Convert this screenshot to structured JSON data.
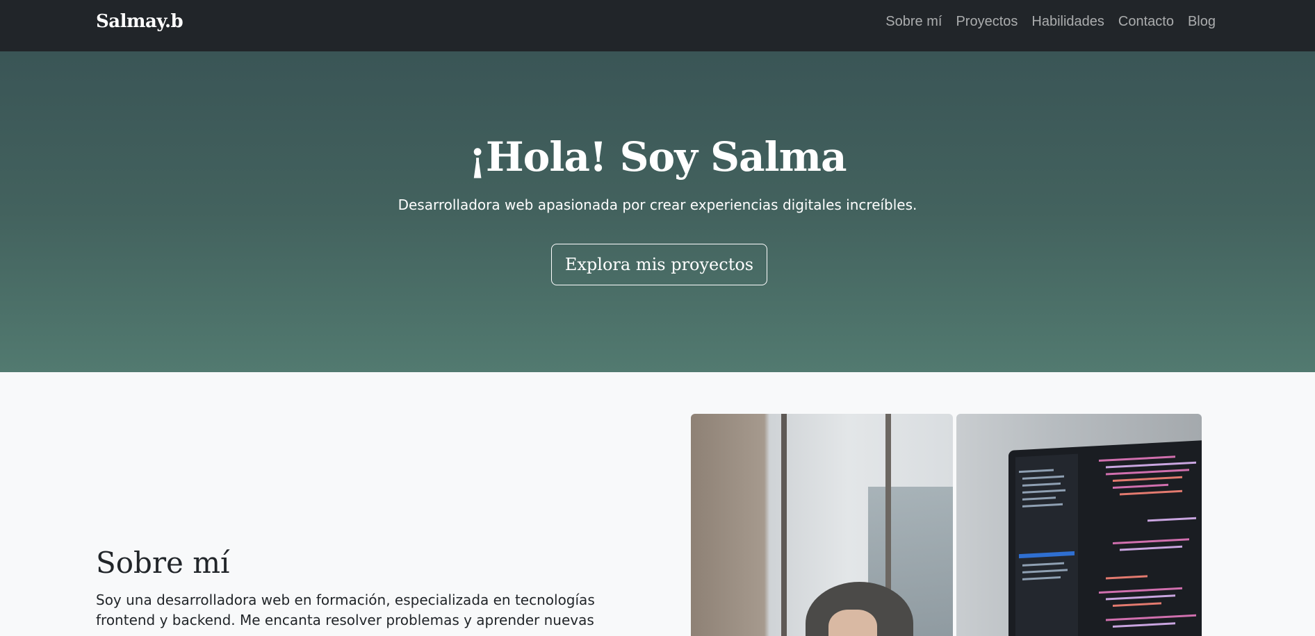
{
  "navbar": {
    "brand": "Salmay.b",
    "links": [
      "Sobre mí",
      "Proyectos",
      "Habilidades",
      "Contacto",
      "Blog"
    ]
  },
  "hero": {
    "title": "¡Hola! Soy Salma",
    "subtitle": "Desarrolladora web apasionada por crear experiencias digitales increíbles.",
    "button_label": "Explora mis proyectos"
  },
  "about": {
    "title": "Sobre mí",
    "text": "Soy una desarrolladora web en formación, especializada en tecnologías frontend y backend. Me encanta resolver problemas y aprender nuevas"
  },
  "colors": {
    "navbar_bg": "#212529",
    "hero_top": "#3a5556",
    "hero_bottom": "#527a70",
    "page_bg": "#f8f9fa"
  }
}
